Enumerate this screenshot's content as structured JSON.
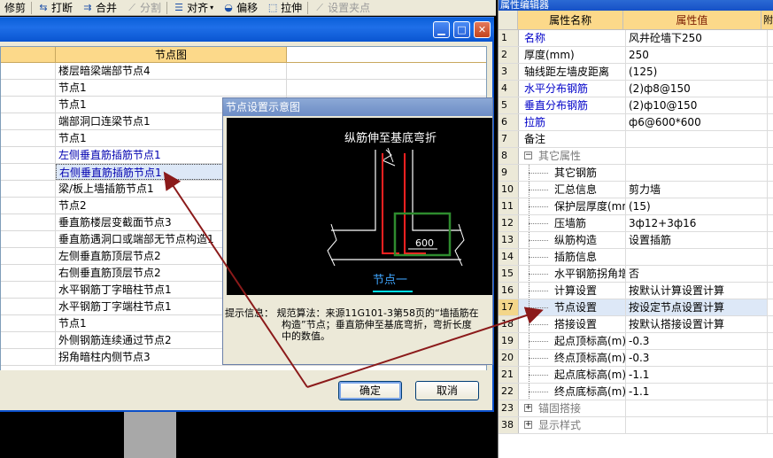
{
  "toolbar": {
    "items": [
      {
        "label": "修剪",
        "icon": "trim-icon",
        "disabled": false
      },
      {
        "label": "打断",
        "icon": "break-icon",
        "disabled": false
      },
      {
        "label": "合并",
        "icon": "merge-icon",
        "disabled": false
      },
      {
        "label": "分割",
        "icon": "split-icon",
        "disabled": true
      },
      {
        "label": "对齐",
        "icon": "align-icon",
        "disabled": false,
        "dropdown": true
      },
      {
        "label": "偏移",
        "icon": "offset-icon",
        "disabled": false
      },
      {
        "label": "拉伸",
        "icon": "stretch-icon",
        "disabled": false
      },
      {
        "label": "设置夹点",
        "icon": "grip-icon",
        "disabled": true
      }
    ]
  },
  "node_dialog": {
    "column_header": "节点图",
    "rows": [
      {
        "text": "楼层暗梁端部节点4",
        "blue": false
      },
      {
        "text": "节点1",
        "blue": false
      },
      {
        "text": "节点1",
        "blue": false
      },
      {
        "text": "端部洞口连梁节点1",
        "blue": false
      },
      {
        "text": "节点1",
        "blue": false
      },
      {
        "text": "左侧垂直筋插筋节点1",
        "blue": true
      },
      {
        "text": "右侧垂直筋插筋节点1",
        "blue": true,
        "selected": true
      },
      {
        "text": "梁/板上墙插筋节点1",
        "blue": false
      },
      {
        "text": "节点2",
        "blue": false
      },
      {
        "text": "垂直筋楼层变截面节点3",
        "blue": false
      },
      {
        "text": "垂直筋遇洞口或端部无节点构造1",
        "blue": false
      },
      {
        "text": "左侧垂直筋顶层节点2",
        "blue": false
      },
      {
        "text": "右侧垂直筋顶层节点2",
        "blue": false
      },
      {
        "text": "水平钢筋丁字暗柱节点1",
        "blue": false
      },
      {
        "text": "水平钢筋丁字端柱节点1",
        "blue": false
      },
      {
        "text": "节点1",
        "blue": false
      },
      {
        "text": "外侧钢筋连续通过节点2",
        "blue": false
      },
      {
        "text": "拐角暗柱内侧节点3",
        "blue": false
      }
    ],
    "ok_label": "确定",
    "cancel_label": "取消"
  },
  "preview": {
    "title": "节点设置示意图",
    "diagram_caption": "纵筋伸至基底弯折",
    "dimension": "600",
    "node_label": "节点一",
    "hint_label": "提示信息：",
    "hint_lines": [
      "规范算法：来源11G101-3第58页的“墙插筋在",
      "构造”节点；垂直筋伸至基底弯折，弯折长度",
      "中的数值。"
    ]
  },
  "properties": {
    "title": "属性编辑器",
    "col_name": "属性名称",
    "col_value": "属性值",
    "col_extra": "附",
    "rows": [
      {
        "num": "1",
        "name": "名称",
        "value": "风井砼墙下250",
        "type": "blue"
      },
      {
        "num": "2",
        "name": "厚度(mm)",
        "value": "250",
        "type": "normal"
      },
      {
        "num": "3",
        "name": "轴线距左墙皮距离",
        "value": "(125)",
        "type": "normal"
      },
      {
        "num": "4",
        "name": "水平分布钢筋",
        "value": "(2)ф8@150",
        "type": "blue"
      },
      {
        "num": "5",
        "name": "垂直分布钢筋",
        "value": "(2)ф10@150",
        "type": "blue"
      },
      {
        "num": "6",
        "name": "拉筋",
        "value": "ф6@600*600",
        "type": "blue"
      },
      {
        "num": "7",
        "name": "备注",
        "value": "",
        "type": "normal"
      },
      {
        "num": "8",
        "name": "其它属性",
        "value": "",
        "type": "group",
        "toggle": "−"
      },
      {
        "num": "9",
        "name": "其它钢筋",
        "value": "",
        "type": "child"
      },
      {
        "num": "10",
        "name": "汇总信息",
        "value": "剪力墙",
        "type": "child"
      },
      {
        "num": "11",
        "name": "保护层厚度(mm)",
        "value": "(15)",
        "type": "child"
      },
      {
        "num": "12",
        "name": "压墙筋",
        "value": "3ф12+3ф16",
        "type": "child"
      },
      {
        "num": "13",
        "name": "纵筋构造",
        "value": "设置插筋",
        "type": "child"
      },
      {
        "num": "14",
        "name": "插筋信息",
        "value": "",
        "type": "child"
      },
      {
        "num": "15",
        "name": "水平钢筋拐角增",
        "value": "否",
        "type": "child"
      },
      {
        "num": "16",
        "name": "计算设置",
        "value": "按默认计算设置计算",
        "type": "child"
      },
      {
        "num": "17",
        "name": "节点设置",
        "value": "按设定节点设置计算",
        "type": "child",
        "selected": true
      },
      {
        "num": "18",
        "name": "搭接设置",
        "value": "按默认搭接设置计算",
        "type": "child"
      },
      {
        "num": "19",
        "name": "起点顶标高(m)",
        "value": "-0.3",
        "type": "child"
      },
      {
        "num": "20",
        "name": "终点顶标高(m)",
        "value": "-0.3",
        "type": "child"
      },
      {
        "num": "21",
        "name": "起点底标高(m)",
        "value": "-1.1",
        "type": "child"
      },
      {
        "num": "22",
        "name": "终点底标高(m)",
        "value": "-1.1",
        "type": "child"
      },
      {
        "num": "23",
        "name": "锚固搭接",
        "value": "",
        "type": "group",
        "toggle": "+"
      },
      {
        "num": "38",
        "name": "显示样式",
        "value": "",
        "type": "group",
        "toggle": "+"
      }
    ]
  },
  "colors": {
    "annotation_arrow": "#8b1a1a",
    "rebar_red": "#ff2020",
    "highlight_green": "#2e8b2e",
    "title_blue": "#0a5fd8"
  }
}
